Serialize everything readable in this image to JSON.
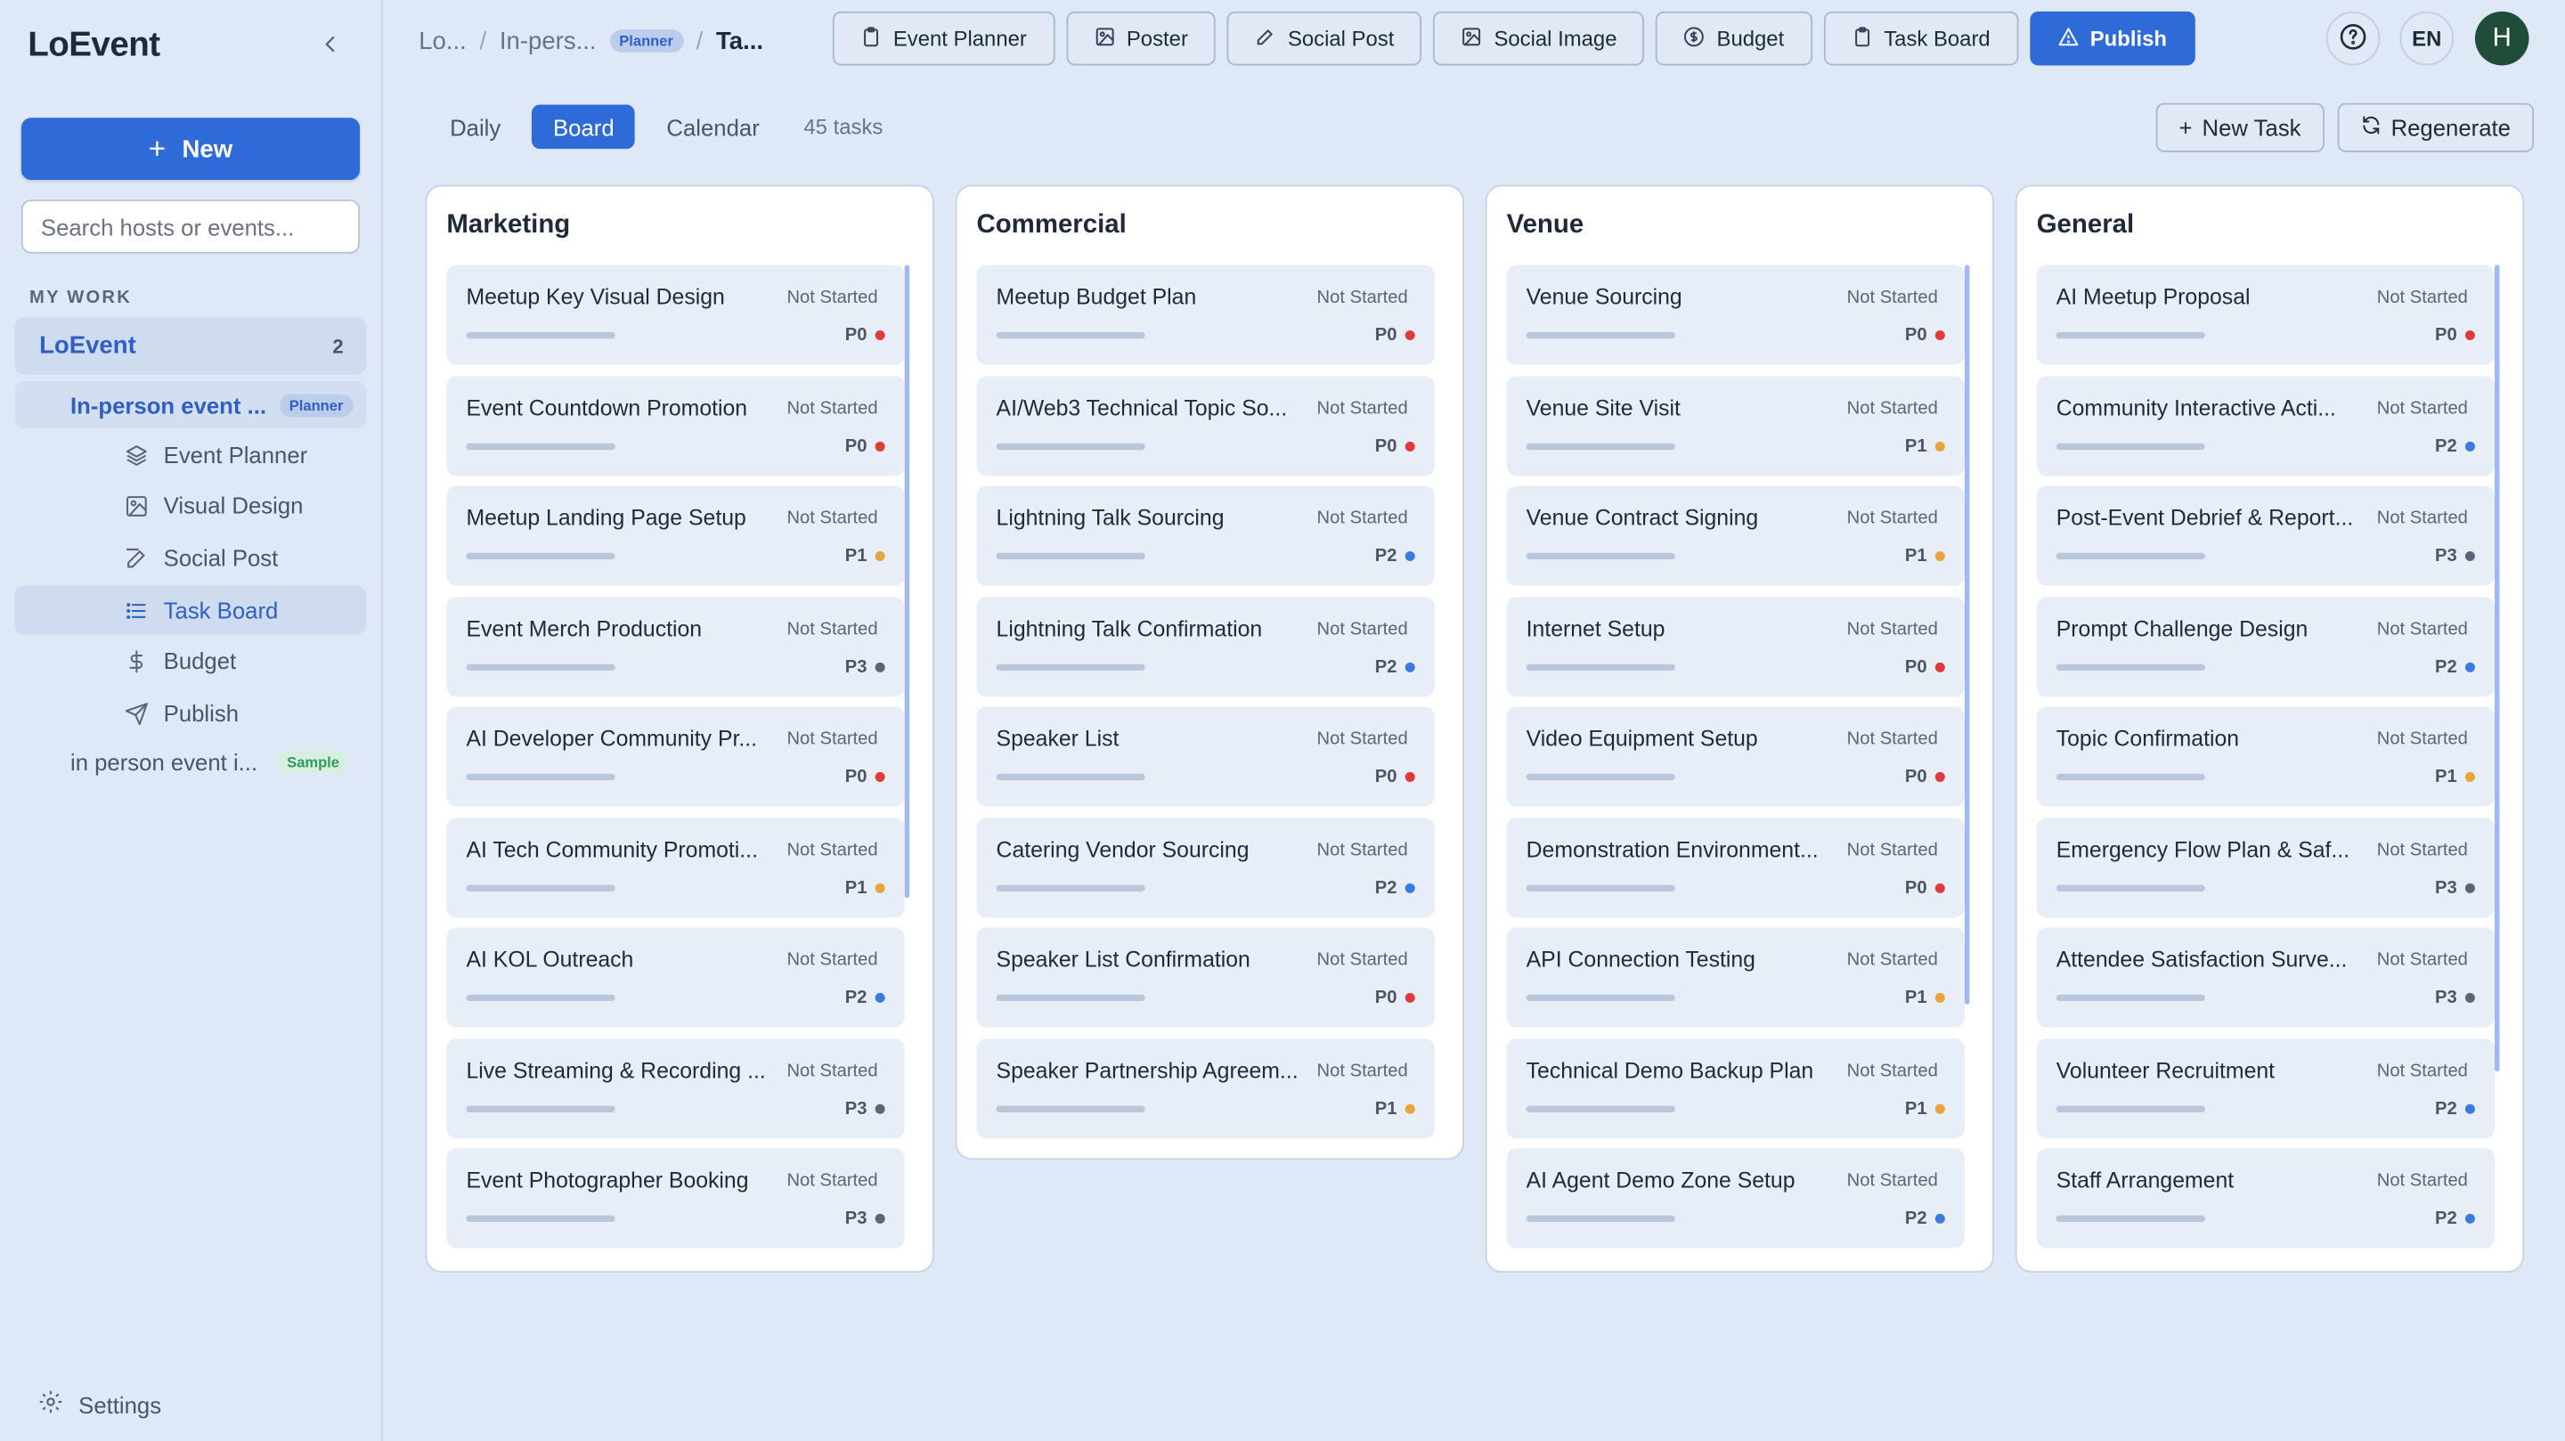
{
  "app": {
    "brand": "LoEvent",
    "new_label": "New",
    "search_placeholder": "Search hosts or events...",
    "section_label": "MY WORK",
    "host": {
      "name": "LoEvent",
      "count": "2"
    },
    "event": {
      "name": "In-person event ...",
      "tag": "Planner"
    },
    "nav": [
      {
        "label": "Event Planner",
        "icon": "layers-icon"
      },
      {
        "label": "Visual Design",
        "icon": "image-icon"
      },
      {
        "label": "Social Post",
        "icon": "edit-icon"
      },
      {
        "label": "Task Board",
        "icon": "list-icon"
      },
      {
        "label": "Budget",
        "icon": "dollar-icon"
      },
      {
        "label": "Publish",
        "icon": "send-icon"
      }
    ],
    "event2": {
      "name": "in person event i...",
      "tag": "Sample"
    },
    "settings_label": "Settings"
  },
  "header": {
    "breadcrumb": {
      "root": "Lo...",
      "event": "In-pers...",
      "event_tag": "Planner",
      "current": "Ta..."
    },
    "toolbar": [
      {
        "label": "Event Planner",
        "icon": "clipboard-icon"
      },
      {
        "label": "Poster",
        "icon": "image-icon"
      },
      {
        "label": "Social Post",
        "icon": "edit-icon"
      },
      {
        "label": "Social Image",
        "icon": "image-icon"
      },
      {
        "label": "Budget",
        "icon": "dollar-circle-icon"
      },
      {
        "label": "Task Board",
        "icon": "clipboard-icon"
      },
      {
        "label": "Publish",
        "icon": "warning-icon"
      }
    ],
    "lang": "EN",
    "avatar_initial": "H"
  },
  "board": {
    "views": [
      "Daily",
      "Board",
      "Calendar"
    ],
    "active_view": "Board",
    "task_count": "45 tasks",
    "new_task_label": "New Task",
    "regenerate_label": "Regenerate",
    "colors": {
      "P0": "#e03b3b",
      "P1": "#e9a33b",
      "P2": "#3b7be0",
      "P3": "#5b6577"
    },
    "columns": [
      {
        "title": "Marketing",
        "tasks": [
          {
            "title": "Meetup Key Visual Design",
            "status": "Not Started",
            "priority": "P0"
          },
          {
            "title": "Event Countdown Promotion",
            "status": "Not Started",
            "priority": "P0"
          },
          {
            "title": "Meetup Landing Page Setup",
            "status": "Not Started",
            "priority": "P1"
          },
          {
            "title": "Event Merch Production",
            "status": "Not Started",
            "priority": "P3"
          },
          {
            "title": "AI Developer Community Pr...",
            "status": "Not Started",
            "priority": "P0"
          },
          {
            "title": "AI Tech Community Promoti...",
            "status": "Not Started",
            "priority": "P1"
          },
          {
            "title": "AI KOL Outreach",
            "status": "Not Started",
            "priority": "P2"
          },
          {
            "title": "Live Streaming & Recording ...",
            "status": "Not Started",
            "priority": "P3"
          },
          {
            "title": "Event Photographer Booking",
            "status": "Not Started",
            "priority": "P3"
          }
        ]
      },
      {
        "title": "Commercial",
        "tasks": [
          {
            "title": "Meetup Budget Plan",
            "status": "Not Started",
            "priority": "P0"
          },
          {
            "title": "AI/Web3 Technical Topic So...",
            "status": "Not Started",
            "priority": "P0"
          },
          {
            "title": "Lightning Talk Sourcing",
            "status": "Not Started",
            "priority": "P2"
          },
          {
            "title": "Lightning Talk Confirmation",
            "status": "Not Started",
            "priority": "P2"
          },
          {
            "title": "Speaker List",
            "status": "Not Started",
            "priority": "P0"
          },
          {
            "title": "Catering Vendor Sourcing",
            "status": "Not Started",
            "priority": "P2"
          },
          {
            "title": "Speaker List Confirmation",
            "status": "Not Started",
            "priority": "P0"
          },
          {
            "title": "Speaker Partnership Agreem...",
            "status": "Not Started",
            "priority": "P1"
          }
        ]
      },
      {
        "title": "Venue",
        "tasks": [
          {
            "title": "Venue Sourcing",
            "status": "Not Started",
            "priority": "P0"
          },
          {
            "title": "Venue Site Visit",
            "status": "Not Started",
            "priority": "P1"
          },
          {
            "title": "Venue Contract Signing",
            "status": "Not Started",
            "priority": "P1"
          },
          {
            "title": "Internet Setup",
            "status": "Not Started",
            "priority": "P0"
          },
          {
            "title": "Video Equipment Setup",
            "status": "Not Started",
            "priority": "P0"
          },
          {
            "title": "Demonstration Environment...",
            "status": "Not Started",
            "priority": "P0"
          },
          {
            "title": "API Connection Testing",
            "status": "Not Started",
            "priority": "P1"
          },
          {
            "title": "Technical Demo Backup Plan",
            "status": "Not Started",
            "priority": "P1"
          },
          {
            "title": "AI Agent Demo Zone Setup",
            "status": "Not Started",
            "priority": "P2"
          }
        ]
      },
      {
        "title": "General",
        "tasks": [
          {
            "title": "AI Meetup Proposal",
            "status": "Not Started",
            "priority": "P0"
          },
          {
            "title": "Community Interactive Acti...",
            "status": "Not Started",
            "priority": "P2"
          },
          {
            "title": "Post-Event Debrief & Report...",
            "status": "Not Started",
            "priority": "P3"
          },
          {
            "title": "Prompt Challenge Design",
            "status": "Not Started",
            "priority": "P2"
          },
          {
            "title": "Topic Confirmation",
            "status": "Not Started",
            "priority": "P1"
          },
          {
            "title": "Emergency Flow Plan & Saf...",
            "status": "Not Started",
            "priority": "P3"
          },
          {
            "title": "Attendee Satisfaction Surve...",
            "status": "Not Started",
            "priority": "P3"
          },
          {
            "title": "Volunteer Recruitment",
            "status": "Not Started",
            "priority": "P2"
          },
          {
            "title": "Staff Arrangement",
            "status": "Not Started",
            "priority": "P2"
          }
        ]
      }
    ]
  }
}
